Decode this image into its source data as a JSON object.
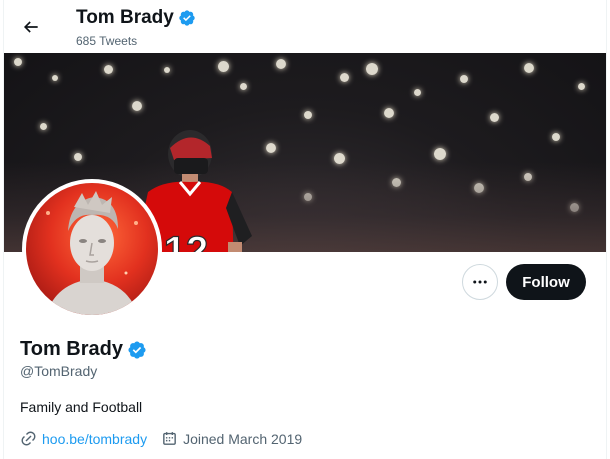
{
  "header": {
    "title": "Tom Brady",
    "tweet_count": "685 Tweets"
  },
  "banner": {
    "jersey_number": "12"
  },
  "actions": {
    "more_label": "•••",
    "follow_label": "Follow"
  },
  "profile": {
    "name": "Tom Brady",
    "handle": "@TomBrady",
    "bio": "Family and Football",
    "website": "hoo.be/tombrady",
    "joined": "Joined March 2019"
  },
  "icons": {
    "back": "arrow-left-icon",
    "verified": "verified-badge-icon",
    "more": "ellipsis-icon",
    "link": "link-icon",
    "calendar": "calendar-icon"
  },
  "colors": {
    "accent": "#1d9bf0",
    "text_primary": "#0f1419",
    "text_secondary": "#536471",
    "follow_bg": "#0f1419",
    "jersey_red": "#d50a0a"
  }
}
